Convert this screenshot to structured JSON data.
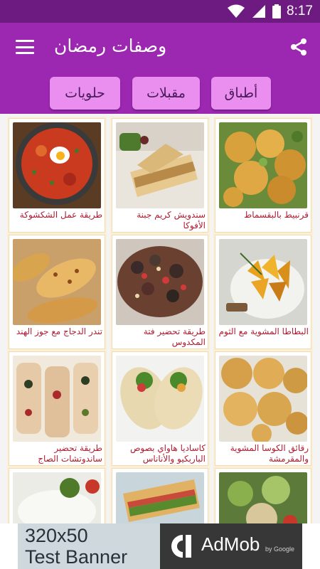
{
  "status_bar": {
    "time": "8:17"
  },
  "app_bar": {
    "title": "وصفات رمضان"
  },
  "tabs": [
    {
      "label": "أطباق"
    },
    {
      "label": "مقبلات"
    },
    {
      "label": "حلويات"
    }
  ],
  "recipes": [
    {
      "title": "قرنبيط بالبقسماط",
      "icon": "fried-cauliflower-photo"
    },
    {
      "title": "سندويش كريم جبنة الأفوكا",
      "icon": "sandwich-photo"
    },
    {
      "title": "طريقة عمل الشكشوكة",
      "icon": "shakshuka-photo"
    },
    {
      "title": "البطاطا المشوية مع الثوم",
      "icon": "roasted-potatoes-photo"
    },
    {
      "title": "طريقة تحضير فتة المكدوس",
      "icon": "fatteh-photo"
    },
    {
      "title": "تندر الدجاج مع جوز الهند",
      "icon": "chicken-tenders-photo"
    },
    {
      "title": "رقائق الكوسا المشوية والمقرمشة",
      "icon": "zucchini-chips-photo"
    },
    {
      "title": "كاساديا هاواي بصوص الباربكيو والأناناس",
      "icon": "quesadilla-wraps-photo"
    },
    {
      "title": "طريقة تحضير ساندوتشات الصاج",
      "icon": "saj-sandwiches-photo"
    },
    {
      "title": "",
      "icon": "salad-photo"
    },
    {
      "title": "",
      "icon": "toast-sandwich-photo"
    },
    {
      "title": "",
      "icon": "cheese-appetizer-photo"
    }
  ],
  "ad": {
    "line1": "320x50",
    "line2": "Test Banner",
    "brand": "AdMob",
    "by": "by Google"
  },
  "colors": {
    "primary": "#9c27b0",
    "status": "#6d1b80",
    "tab": "#ea8ff0",
    "label": "#b01c32"
  }
}
